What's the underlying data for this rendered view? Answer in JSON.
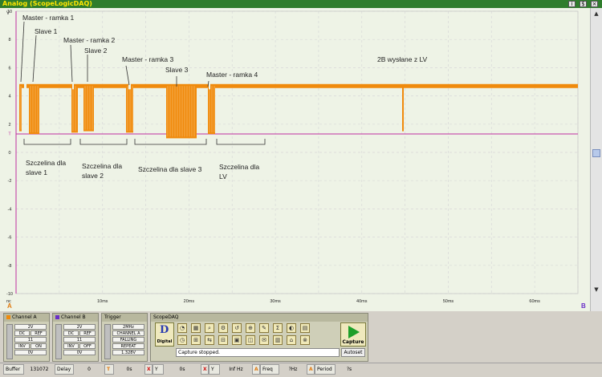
{
  "window": {
    "title": "Analog (ScopeLogicDAQ)",
    "buttons": [
      "i",
      "$",
      "×"
    ]
  },
  "plot": {
    "y_unit": "V",
    "y_ticks": [
      "10",
      "8",
      "6",
      "4",
      "2",
      "T",
      "0",
      "-2",
      "-4",
      "-6",
      "-8",
      "-10"
    ],
    "x_ticks": [
      "0s",
      "10ms",
      "20ms",
      "30ms",
      "40ms",
      "50ms",
      "60ms"
    ],
    "x_axis_start_label": "nc",
    "left_marker": "A",
    "right_marker": "B",
    "signal_color": "#f08a0c",
    "trigger_line_color": "#c02fa0",
    "annotations": {
      "m1": "Master - ramka 1",
      "s1": "Slave 1",
      "m2": "Master - ramka 2",
      "s2": "Slave 2",
      "m3": "Master - ramka 3",
      "s3": "Slave 3",
      "m4": "Master - ramka 4",
      "lv": "2B wysłane z LV",
      "g1a": "Szczelina dla",
      "g1b": "slave 1",
      "g2a": "Szczelina dla",
      "g2b": "slave 2",
      "g3": "Szczelina dla slave 3",
      "g4a": "Szczelina dla",
      "g4b": "LV"
    }
  },
  "channel_a": {
    "title": "Channel A",
    "color": "#f08a0c",
    "volts": "2V",
    "coupling": "DC",
    "ref": "REF",
    "row3": "11",
    "inv": "INV",
    "state": "ON",
    "offset": "0V"
  },
  "channel_b": {
    "title": "Channel B",
    "color": "#6a2fc8",
    "volts": "2V",
    "coupling": "DC",
    "ref": "REF",
    "row3": "11",
    "inv": "INV",
    "state": "OFF",
    "offset": "0V"
  },
  "trigger": {
    "title": "Trigger",
    "rate": "2MHz",
    "source": "CHANNEL A",
    "edge": "FALLING",
    "mode": "REPEAT",
    "level": "1.328V"
  },
  "scopedaq": {
    "title": "ScopeDAQ",
    "digital_letter": "D",
    "digital_label": "Digital",
    "capture_label": "Capture",
    "status_text": "Capture stopped.",
    "autoset_label": "Autoset"
  },
  "statusbar": {
    "buffer_label": "Buffer",
    "buffer_value": "131072",
    "delay_label": "Delay",
    "delay_value": "0",
    "t_label": "T",
    "t_value": "0s",
    "x_label": "X",
    "y_label": "Y",
    "xy_value": "0s",
    "x2_label": "X",
    "y2_label": "Y",
    "freq_value": "Inf Hz",
    "a_label": "A",
    "freq_label": "Freq",
    "freq_q": "?Hz",
    "a2_label": "A",
    "period_label": "Period",
    "period_q": "?s"
  }
}
